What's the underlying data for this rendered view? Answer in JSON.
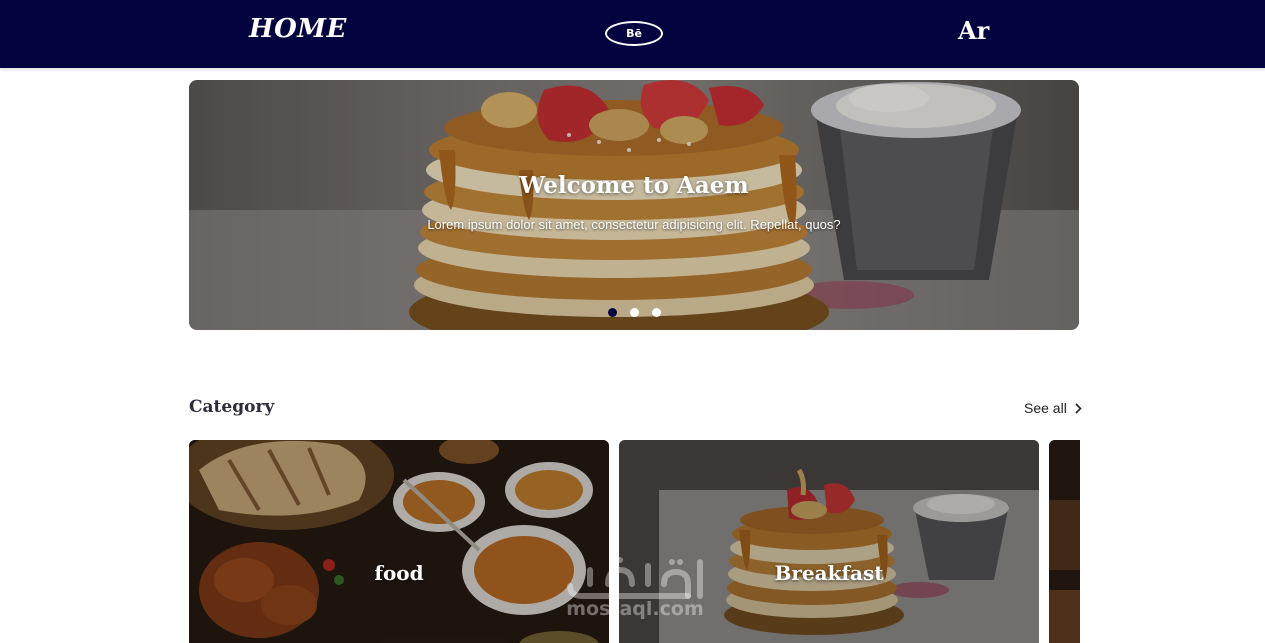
{
  "navbar": {
    "home_label": "HOME",
    "behance_label": "Bē",
    "language_label": "Ar",
    "background": "#03033f"
  },
  "hero": {
    "title": "Welcome to Aaem",
    "text": "Lorem ipsum dolor sit amet, consectetur adipisicing elit. Repellat, quos?",
    "slide_count": 3,
    "active_slide": 1
  },
  "category": {
    "title": "Category",
    "see_all_label": "See all",
    "cards": [
      {
        "label": "food"
      },
      {
        "label": "Breakfast"
      }
    ]
  },
  "watermark": {
    "text": "mostaql.com"
  },
  "colors": {
    "accent": "#03033f",
    "text_dark": "#2c2c3a"
  }
}
